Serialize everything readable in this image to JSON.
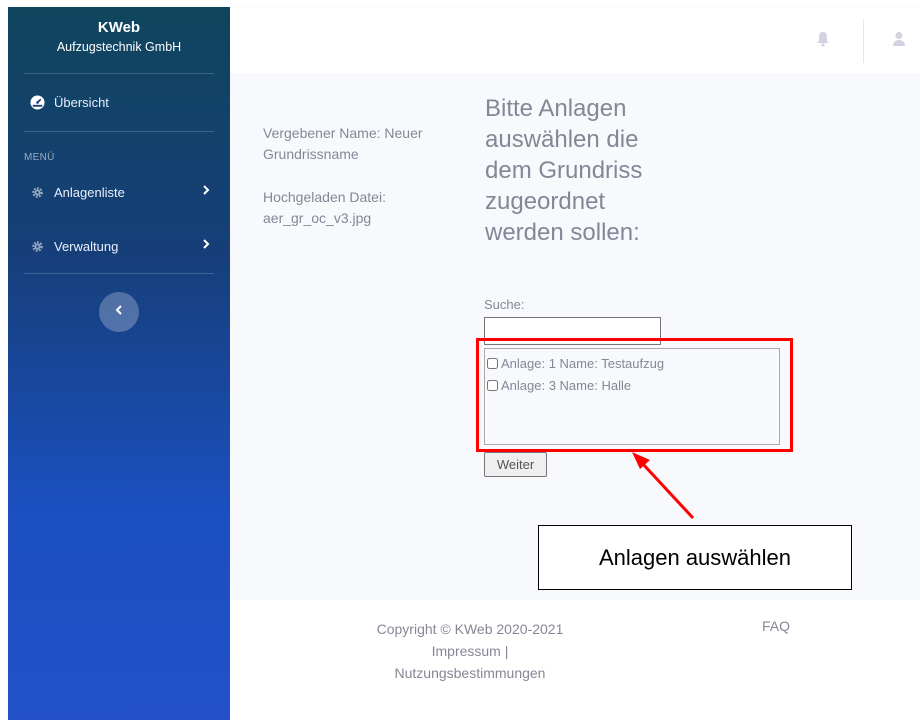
{
  "brand": {
    "title": "KWeb",
    "subtitle": "Aufzugstechnik GmbH"
  },
  "sidebar": {
    "overview_label": "Übersicht",
    "section_label": "MENÜ",
    "items": [
      {
        "label": "Anlagenliste",
        "icon": "gear-icon"
      },
      {
        "label": "Verwaltung",
        "icon": "gear-icon"
      }
    ]
  },
  "topbar": {
    "icons": [
      "bell-icon",
      "user-icon"
    ]
  },
  "main": {
    "info_name": "Vergebener Name: Neuer Grundrissname",
    "info_file": "Hochgeladen Datei: aer_gr_oc_v3.jpg",
    "heading": "Bitte Anlagen auswählen die dem Grundriss zugeordnet werden sollen:",
    "search_label": "Suche:",
    "search_value": "",
    "list": [
      {
        "label": "Anlage: 1 Name: Testaufzug",
        "checked": false
      },
      {
        "label": "Anlage: 3 Name: Halle",
        "checked": false
      }
    ],
    "button_label": "Weiter"
  },
  "annotation": {
    "label": "Anlagen auswählen",
    "color": "#ff0000"
  },
  "footer": {
    "copyright": "Copyright © KWeb 2020-2021",
    "impressum": "Impressum |",
    "nutzung": "Nutzungsbestimmungen",
    "faq": "FAQ"
  }
}
